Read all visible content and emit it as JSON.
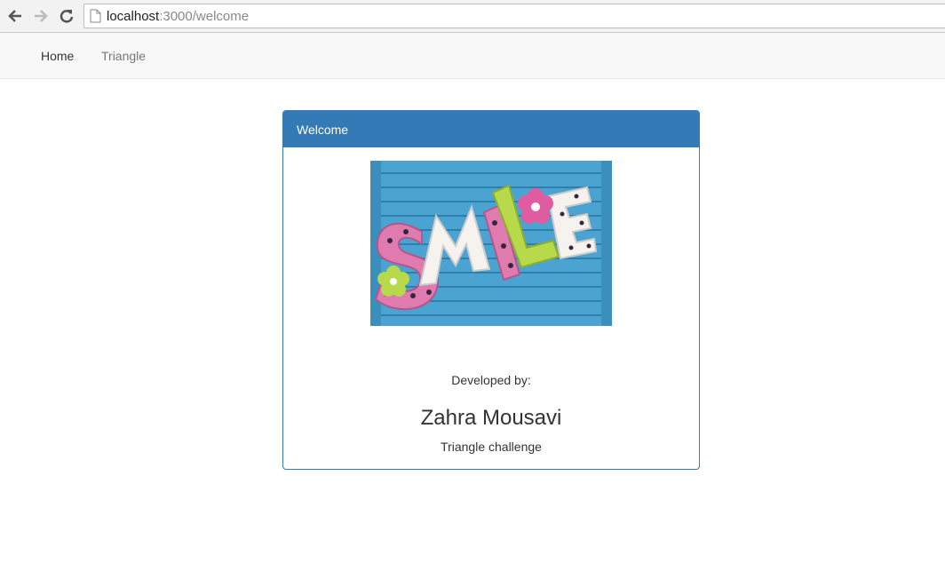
{
  "browser": {
    "url_host": "localhost",
    "url_rest": ":3000/welcome",
    "icons": [
      "back-arrow-icon",
      "forward-arrow-icon",
      "reload-icon",
      "page-icon"
    ]
  },
  "navbar": {
    "items": [
      {
        "label": "Home",
        "active": true
      },
      {
        "label": "Triangle",
        "active": false
      }
    ]
  },
  "panel": {
    "title": "Welcome",
    "image_text": "SMILE",
    "developed_by_label": "Developed by:",
    "developer_name": "Zahra Mousavi",
    "subtitle": "Triangle challenge"
  },
  "colors": {
    "primary": "#337ab7",
    "navbar_bg": "#f8f8f8",
    "image_bg": "#4aa3d0"
  }
}
